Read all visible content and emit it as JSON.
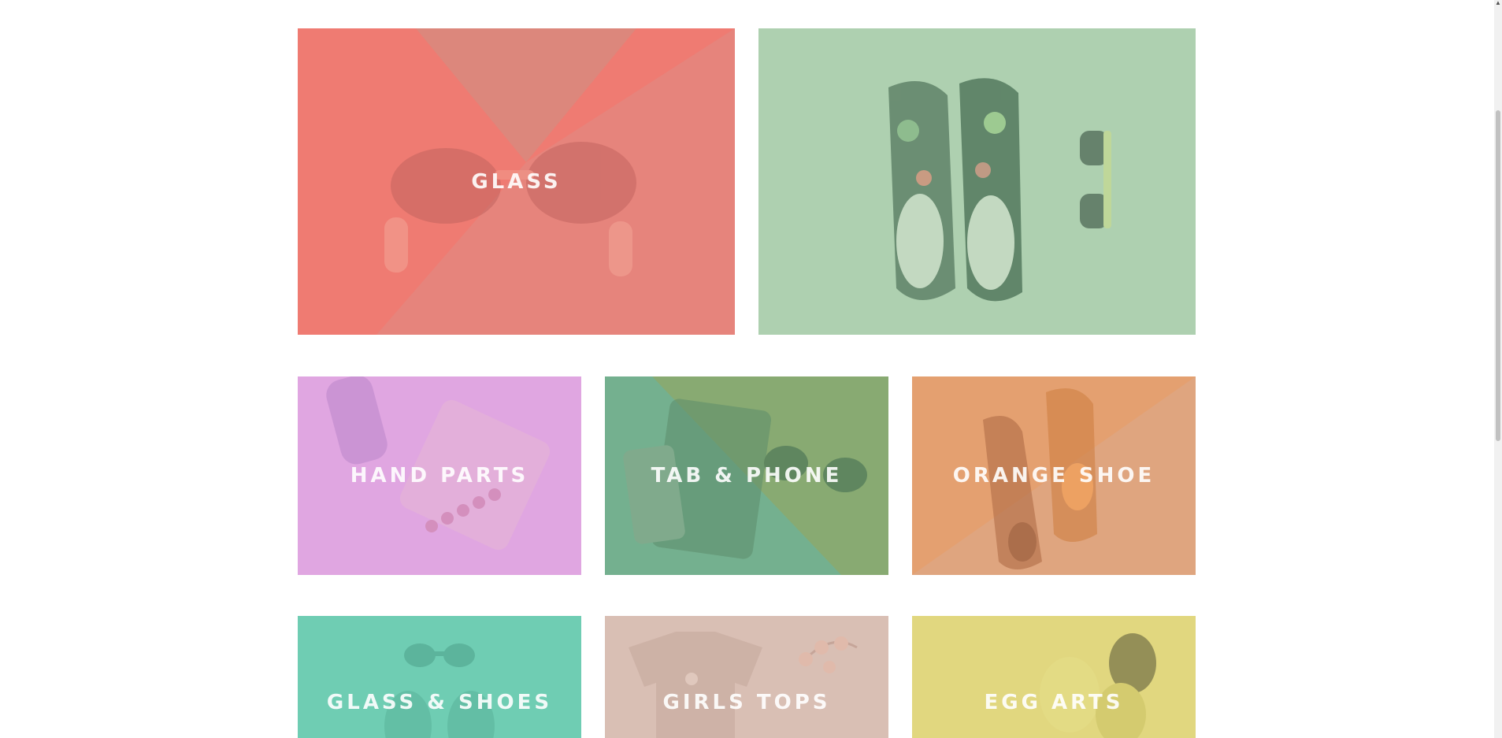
{
  "categories": [
    {
      "id": "glass",
      "label": "GLASS",
      "color": "#ef7b72"
    },
    {
      "id": "shoes",
      "label": "",
      "color": "#aed0b0"
    },
    {
      "id": "hand_parts",
      "label": "HAND PARTS",
      "color": "#e0a6e1"
    },
    {
      "id": "tab_phone",
      "label": "TAB & PHONE",
      "color": "#7db28a"
    },
    {
      "id": "orange_shoe",
      "label": "ORANGE SHOE",
      "color": "#e4a070"
    },
    {
      "id": "glass_shoes",
      "label": "GLASS & SHOES",
      "color": "#6fcdb3"
    },
    {
      "id": "girls_tops",
      "label": "GIRLS TOPS",
      "color": "#d9bfb4"
    },
    {
      "id": "egg_arts",
      "label": "EGG ARTS",
      "color": "#e1d77f"
    }
  ],
  "icons": {
    "glass": "sunglasses-icon",
    "shoes": "sneakers-icon",
    "hand_parts": "bracelets-icon",
    "tab_phone": "tablet-phone-icon",
    "orange_shoe": "oxford-shoes-icon",
    "glass_shoes": "sunglasses-shoes-icon",
    "girls_tops": "t-shirt-icon",
    "egg_arts": "egg-icon"
  }
}
